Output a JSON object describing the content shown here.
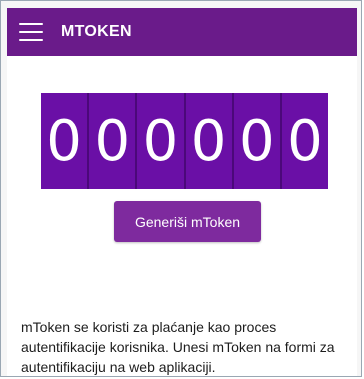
{
  "app_bar": {
    "title": "MTOKEN",
    "menu_icon": "hamburger-menu-icon"
  },
  "token": {
    "digits": [
      "0",
      "0",
      "0",
      "0",
      "0",
      "0"
    ]
  },
  "actions": {
    "generate_label": "Generiši mToken"
  },
  "info": {
    "description": "mToken se koristi za plaćanje kao proces autentifikacije korisnika. Unesi mToken na formi za autentifikaciju na web aplikaciji."
  },
  "colors": {
    "app_bar": "#6a1b8a",
    "token_bg": "#6a0fa6",
    "button_bg": "#7e2a9e",
    "text": "#1d1d1d"
  }
}
